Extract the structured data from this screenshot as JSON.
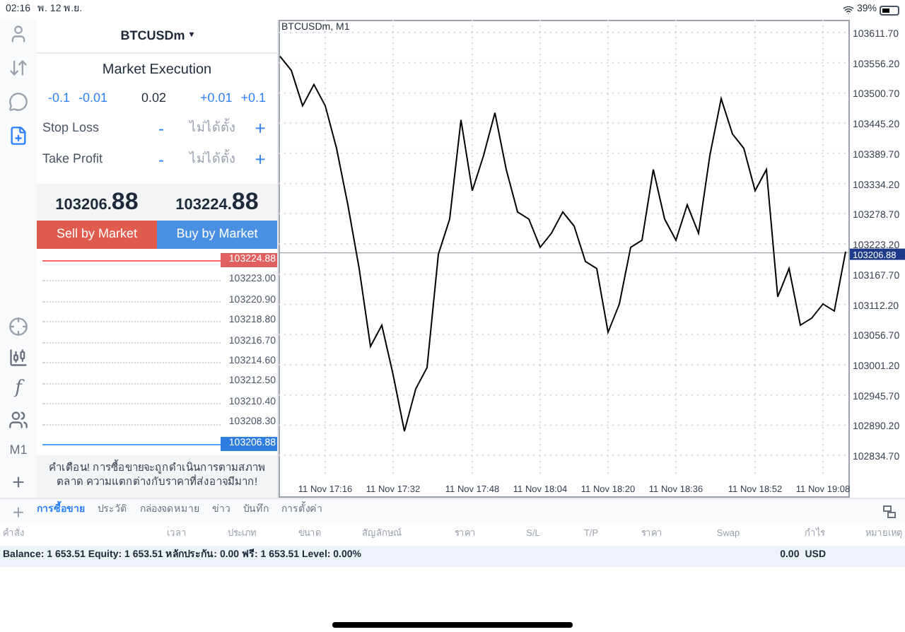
{
  "status_bar": {
    "time": "02:16",
    "date": "พ. 12 พ.ย.",
    "battery": "39%"
  },
  "toolbar": {
    "items": [
      {
        "kind": "account",
        "selected": false
      },
      {
        "kind": "trade",
        "selected": false
      },
      {
        "kind": "chat",
        "selected": false
      },
      {
        "kind": "new-order",
        "selected": true
      }
    ],
    "chart_tools": [
      {
        "kind": "crosshair"
      },
      {
        "kind": "candles"
      },
      {
        "kind": "indicator",
        "label": "f"
      },
      {
        "kind": "objects"
      },
      {
        "kind": "timeframe",
        "label": "M1"
      },
      {
        "kind": "add",
        "label": "+"
      }
    ]
  },
  "order_panel": {
    "symbol": "BTCUSDm",
    "caret": "▾",
    "mode": "Market Execution",
    "volume_steps": [
      {
        "label": "-0.1"
      },
      {
        "label": "-0.01"
      },
      {
        "label": "0.02",
        "kind": "value"
      },
      {
        "label": "+0.01"
      },
      {
        "label": "+0.1"
      }
    ],
    "levels": [
      {
        "label": "Stop Loss",
        "minus": "-",
        "value": "ไม่ได้ตั้ง",
        "plus": "+"
      },
      {
        "label": "Take Profit",
        "minus": "-",
        "value": "ไม่ได้ตั้ง",
        "plus": "+"
      }
    ],
    "bid": {
      "main": "103206.",
      "big": "88"
    },
    "ask": {
      "main": "103224.",
      "big": "88"
    },
    "sell_button": "Sell by Market",
    "buy_button": "Buy by Market",
    "depth": [
      {
        "price": "103224.88",
        "kind": "ask"
      },
      {
        "price": "103223.00"
      },
      {
        "price": "103220.90"
      },
      {
        "price": "103218.80"
      },
      {
        "price": "103216.70"
      },
      {
        "price": "103214.60"
      },
      {
        "price": "103212.50"
      },
      {
        "price": "103210.40"
      },
      {
        "price": "103208.30"
      },
      {
        "price": "103206.88",
        "kind": "bid"
      }
    ],
    "warning": "คำเตือน! การซื้อขายจะถูกดำเนินการตามสภาพตลาด ความแตกต่างกับราคาที่ส่งอาจมีมาก!"
  },
  "chart": {
    "title": "BTCUSDm, M1",
    "chart_data": {
      "type": "line",
      "grid": true,
      "ref_lines": [
        {
          "axis": "y",
          "value": 103206.88,
          "label": "103206.88"
        }
      ],
      "categories": [
        null,
        null,
        null,
        null,
        "11 Nov 17:16",
        null,
        null,
        null,
        null,
        null,
        "11 Nov 17:32",
        null,
        null,
        null,
        null,
        null,
        null,
        "11 Nov 17:48",
        null,
        null,
        null,
        null,
        null,
        "11 Nov 18:04",
        null,
        null,
        null,
        null,
        null,
        "11 Nov 18:20",
        null,
        null,
        null,
        null,
        null,
        "11 Nov 18:36",
        null,
        null,
        null,
        null,
        null,
        null,
        "11 Nov 18:52",
        null,
        null,
        null,
        null,
        null,
        "11 Nov 19:08",
        null,
        null
      ],
      "ylim": [
        102757,
        103635
      ],
      "yticks": [
        {
          "value": 103611.7,
          "label": "103611.70"
        },
        {
          "value": 103556.2,
          "label": "103556.20"
        },
        {
          "value": 103500.7,
          "label": "103500.70"
        },
        {
          "value": 103445.2,
          "label": "103445.20"
        },
        {
          "value": 103389.7,
          "label": "103389.70"
        },
        {
          "value": 103334.2,
          "label": "103334.20"
        },
        {
          "value": 103278.7,
          "label": "103278.70"
        },
        {
          "value": 103223.2,
          "label": "103223.20"
        },
        {
          "value": 103167.7,
          "label": "103167.70"
        },
        {
          "value": 103112.2,
          "label": "103112.20"
        },
        {
          "value": 103056.7,
          "label": "103056.70"
        },
        {
          "value": 103001.2,
          "label": "103001.20"
        },
        {
          "value": 102945.7,
          "label": "102945.70"
        },
        {
          "value": 102890.2,
          "label": "102890.20"
        },
        {
          "value": 102834.7,
          "label": "102834.70"
        }
      ],
      "series": [
        {
          "color": "#000000",
          "values": [
            103568,
            103542,
            103477,
            103516,
            103477,
            103399,
            103295,
            103178,
            103035,
            103074,
            102983,
            102879,
            102957,
            102996,
            103204,
            103269,
            103451,
            103321,
            103386,
            103464,
            103360,
            103282,
            103269,
            103217,
            103243,
            103282,
            103256,
            103191,
            103178,
            103061,
            103113,
            103217,
            103230,
            103360,
            103269,
            103230,
            103295,
            103243,
            103386,
            103490,
            103425,
            103399,
            103321,
            103360,
            103126,
            103178,
            103074,
            103087,
            103113,
            103100,
            103209
          ]
        }
      ]
    }
  },
  "bottom_tabs": {
    "add": "+",
    "tabs": [
      {
        "label": "การซื้อขาย",
        "selected": true
      },
      {
        "label": "ประวัติ",
        "selected": false
      },
      {
        "label": "กล่องจดหมาย",
        "selected": false
      },
      {
        "label": "ข่าว",
        "selected": false
      },
      {
        "label": "บันทึก",
        "selected": false
      },
      {
        "label": "การตั้งค่า",
        "selected": false
      }
    ]
  },
  "table": {
    "columns": [
      "คำสั่ง",
      "เวลา",
      "ประเภท",
      "ขนาด",
      "สัญลักษณ์",
      "ราคา",
      "S/L",
      "T/P",
      "ราคา",
      "Swap",
      "กำไร",
      "หมายเหตุ"
    ],
    "summary": "Balance: 1 653.51 Equity: 1 653.51 หลักประกัน: 0.00 ฟรี: 1 653.51 Level: 0.00%",
    "profit": "0.00",
    "currency": "USD"
  }
}
